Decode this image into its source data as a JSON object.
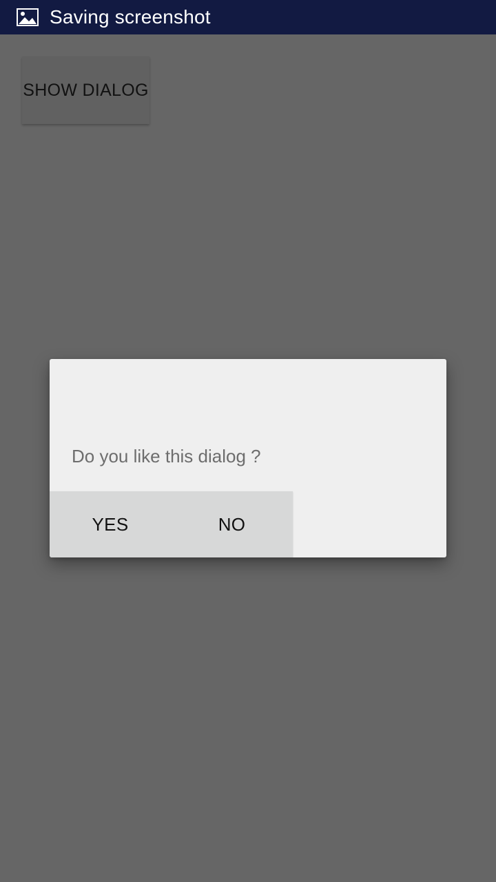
{
  "status_bar": {
    "icon": "image-icon",
    "text": "Saving screenshot"
  },
  "main": {
    "show_dialog_label": "SHOW DIALOG"
  },
  "dialog": {
    "message": "Do you like this dialog ?",
    "yes_label": "YES",
    "no_label": "NO"
  },
  "colors": {
    "status_bar_bg": "#121a42",
    "screen_bg": "#666666",
    "dialog_bg": "#efefef",
    "dialog_buttons_bg": "#d7d8d8"
  }
}
